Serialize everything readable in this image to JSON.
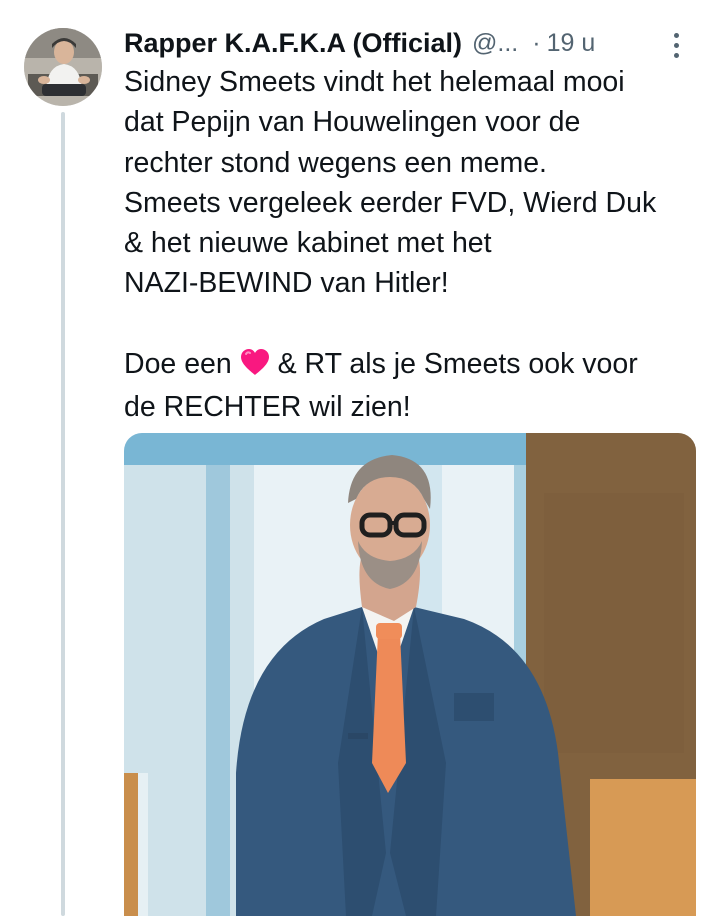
{
  "tweet": {
    "display_name": "Rapper K.A.F.K.A (Official)",
    "handle": "@...",
    "separator": "·",
    "time": "19 u",
    "body": {
      "line1": "Sidney Smeets vindt het helemaal mooi",
      "line2": "dat Pepijn van Houwelingen voor de",
      "line3": "rechter stond wegens een meme.",
      "line4": "Smeets vergeleek eerder FVD, Wierd Duk",
      "line5": "& het nieuwe kabinet met het",
      "line6": "NAZI-BEWIND van Hitler!",
      "line7_before": "Doe een",
      "line7_after": "& RT als je Smeets ook voor",
      "line8": "de RECHTER wil zien!"
    },
    "heart_emoji": "red-heart-icon",
    "more_icon": "more-vertical-icon"
  },
  "colors": {
    "text_primary": "#0f1419",
    "text_secondary": "#536471",
    "thread_line": "#cfd9de",
    "heart": "#f91880"
  }
}
